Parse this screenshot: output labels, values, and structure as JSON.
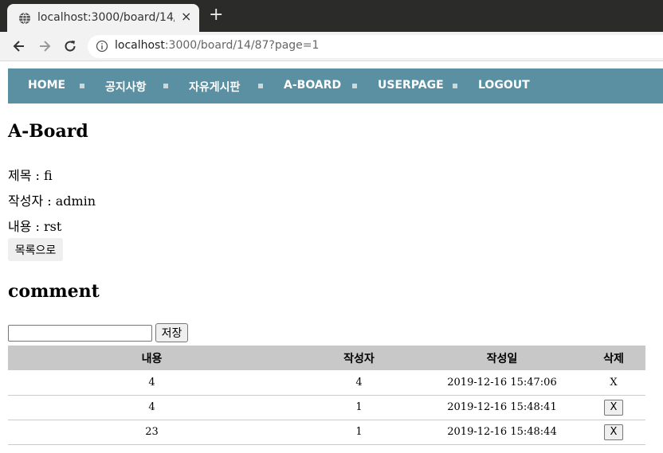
{
  "browser": {
    "tab_title": "localhost:3000/board/14/",
    "tab_close": "×",
    "new_tab": "+",
    "url_host": "localhost",
    "url_path": ":3000/board/14/87?page=1"
  },
  "nav": {
    "items": [
      "HOME",
      "공지사항",
      "자유게시판",
      "A-BOARD",
      "USERPAGE",
      "LOGOUT"
    ]
  },
  "board": {
    "title": "A-Board",
    "subject_line": "제목 : fi",
    "author_line": "작성자 : admin",
    "content_line": "내용 : rst",
    "list_button": "목록으로"
  },
  "comment": {
    "title": "comment",
    "input_value": "",
    "save_button": "저장",
    "headers": [
      "내용",
      "작성자",
      "작성일",
      "삭제"
    ],
    "rows": [
      {
        "content": "4",
        "author": "4",
        "date": "2019-12-16 15:47:06",
        "delete": "X",
        "delete_is_button": false
      },
      {
        "content": "4",
        "author": "1",
        "date": "2019-12-16 15:48:41",
        "delete": "X",
        "delete_is_button": true
      },
      {
        "content": "23",
        "author": "1",
        "date": "2019-12-16 15:48:44",
        "delete": "X",
        "delete_is_button": true
      }
    ]
  },
  "colors": {
    "nav_bg": "#5b8fa2",
    "table_header_bg": "#c8c8c8",
    "chrome_dark": "#2b2b29"
  }
}
